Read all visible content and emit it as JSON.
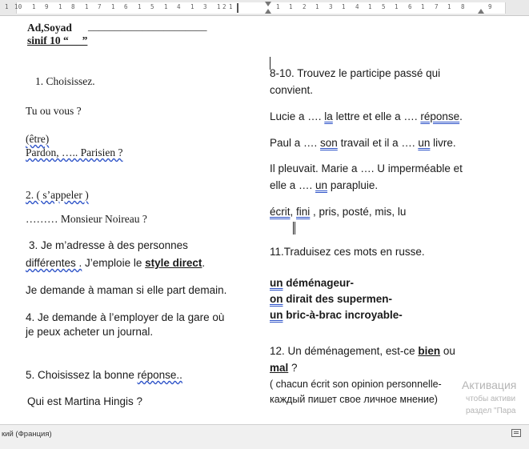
{
  "ruler": {
    "left_marks": [
      "1",
      "10",
      "1",
      "9",
      "1",
      "8",
      "1",
      "7",
      "1",
      "6",
      "1",
      "5",
      "1",
      "4",
      "1",
      "3",
      "1",
      "2",
      "1"
    ],
    "right_marks": [
      "1",
      "1",
      "2",
      "1",
      "3",
      "1",
      "4",
      "1",
      "5",
      "1",
      "6",
      "1",
      "7",
      "1",
      "8",
      "9"
    ]
  },
  "left_column": {
    "name_line": "Ad,Soyad",
    "name_blank": "______________________",
    "class_line": "sinif  10 “ __”",
    "q1": "1. Choisissez.",
    "q1_a": "Tu ou vous ?",
    "etre": "(être)",
    "pardon": "Pardon, ….. Parisien ?",
    "q2": "2. ( s’appeler )",
    "q2_a": "……… Monsieur Noireau ?",
    "q3_line1": "3. Je m’adresse à des personnes",
    "q3_line2_a": "différentes .",
    "q3_line2_b": " J’emploie le ",
    "q3_line2_c": "style direct",
    "q3_line2_d": ".",
    "q3_a": "Je demande à maman si elle part demain.",
    "q4_line1": "4. Je demande à l’employer de la gare où",
    "q4_line2": "je peux acheter un journal.",
    "q5_a": "5. Choisissez la bonne ",
    "q5_b": "réponse..",
    "q5_c": "Qui est Martina Hingis ?"
  },
  "right_column": {
    "q810_line1": "8-10. Trouvez le participe passé qui",
    "q810_line2": "convient.",
    "s1_a": "Lucie a …. ",
    "s1_b": "la",
    "s1_c": " lettre et elle a …. ",
    "s1_d": "réponse",
    "s1_e": ".",
    "s2_a": "Paul a …. ",
    "s2_b": "son",
    "s2_c": " travail et il a …. ",
    "s2_d": "un",
    "s2_e": " livre.",
    "s3_line1": "Il pleuvait. Marie a …. U imperméable et",
    "s3_a": "elle a …. ",
    "s3_b": "un",
    "s3_c": " parapluie.",
    "words_a": "écrit",
    "words_b": ", ",
    "words_c": "fini",
    "words_d": " ,  pris,   posté,    mis,   lu",
    "q11": "11.Traduisez ces mots en russe.",
    "w1_a": "un",
    "w1_b": " déménageur-",
    "w2_a": "on",
    "w2_b": " dirait des supermen-",
    "w3_a": "un",
    "w3_b": " bric-à-brac incroyable-",
    "q12_a": "12. Un déménagement, est-ce ",
    "q12_b": "bien",
    "q12_c": " ou",
    "q12_d": "mal",
    "q12_e": " ?",
    "q12_line3": "( chacun écrit son opinion personnelle-",
    "q12_line4": "каждый пишет свое личное мнение)"
  },
  "watermark": {
    "line1": "Активация",
    "line2": "чтобы активи",
    "line3": "раздел \"Пара"
  },
  "status_bar": {
    "language": "кий (Франция)"
  }
}
